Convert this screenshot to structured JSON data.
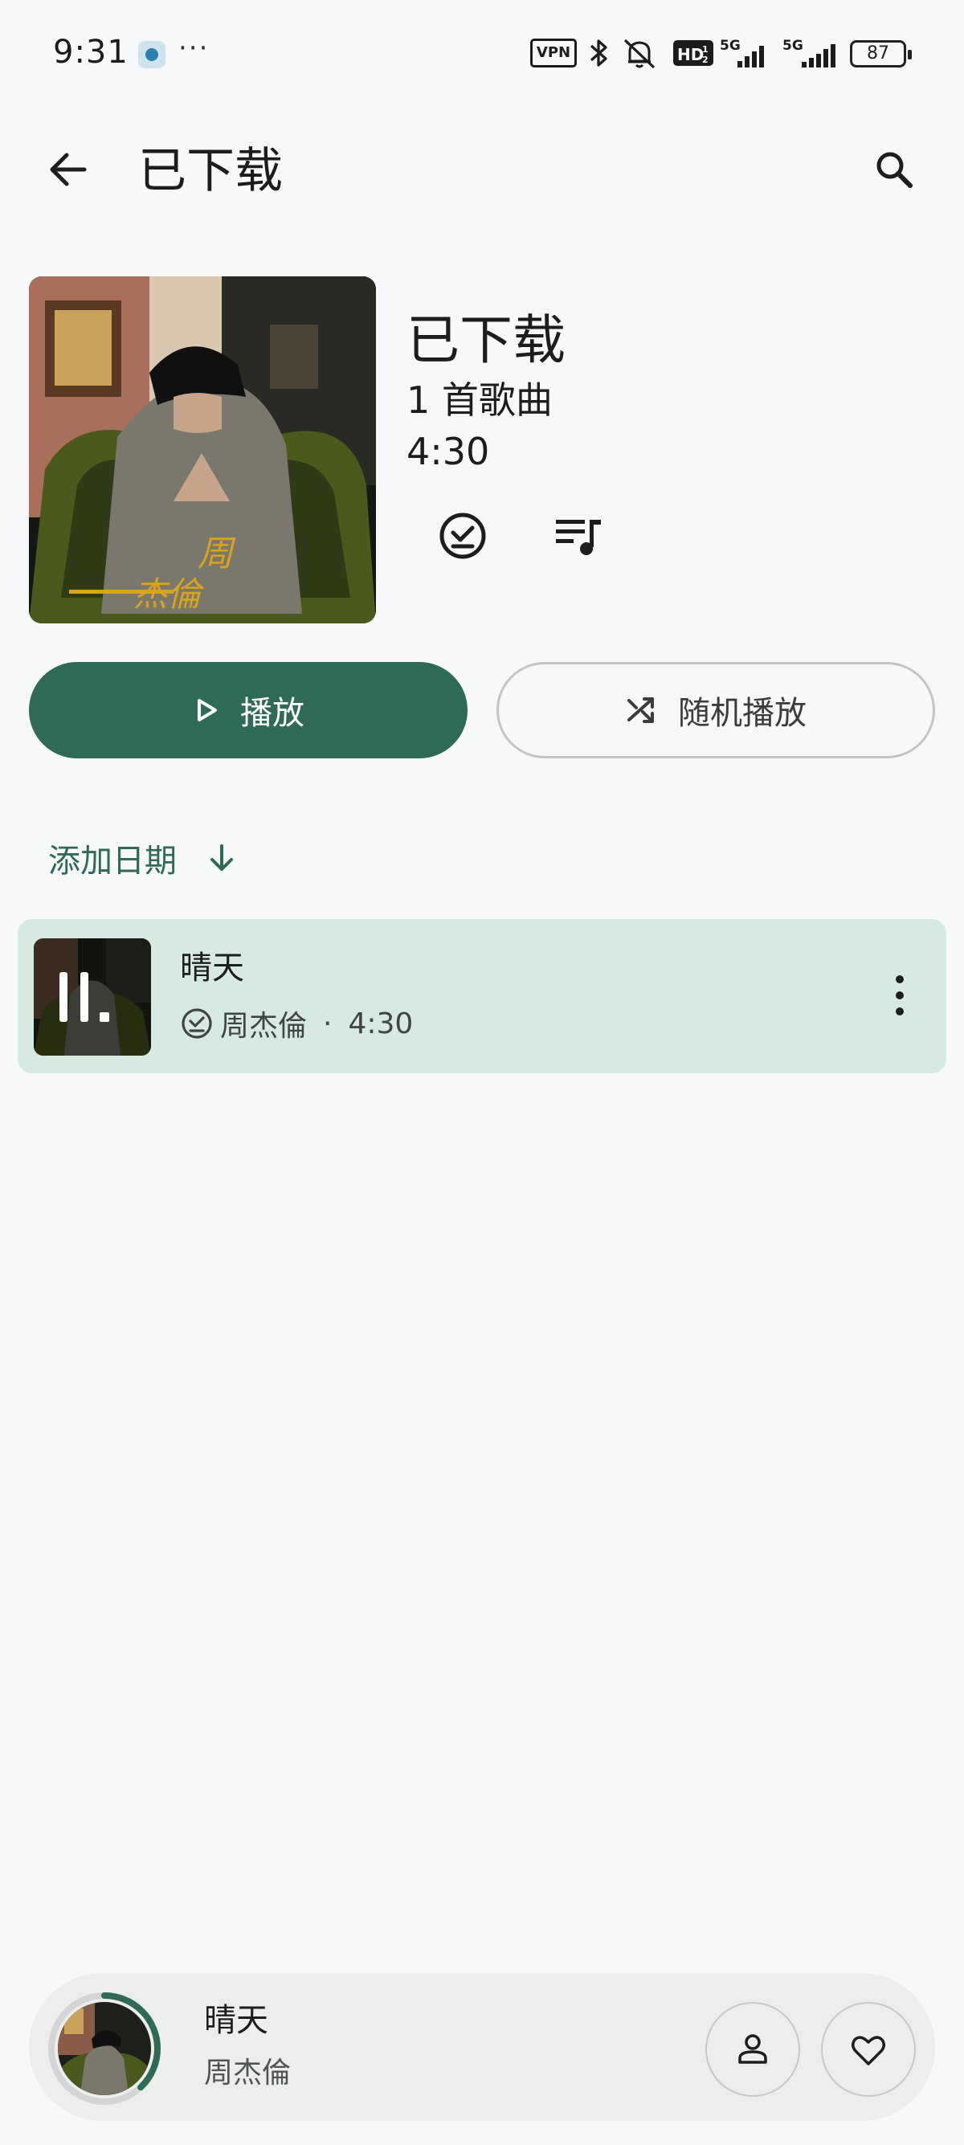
{
  "status_bar": {
    "time": "9:31",
    "more": "···",
    "vpn": "VPN",
    "battery": "87"
  },
  "app_bar": {
    "title": "已下载"
  },
  "header": {
    "title": "已下载",
    "song_count": "1 首歌曲",
    "duration": "4:30"
  },
  "actions": {
    "play_label": "播放",
    "shuffle_label": "随机播放"
  },
  "sort": {
    "label": "添加日期"
  },
  "songs": [
    {
      "title": "晴天",
      "artist": "周杰倫",
      "separator": "·",
      "duration": "4:30"
    }
  ],
  "mini_player": {
    "title": "晴天",
    "artist": "周杰倫",
    "progress": 0.38
  },
  "colors": {
    "accent": "#2e6a54",
    "row_highlight": "#d6eae2",
    "background": "#f7f8f9"
  },
  "icons": [
    "back-arrow-icon",
    "search-icon",
    "download-done-icon",
    "queue-music-icon",
    "play-icon",
    "shuffle-icon",
    "arrow-down-icon",
    "pause-icon",
    "more-vert-icon",
    "person-icon",
    "heart-icon"
  ]
}
